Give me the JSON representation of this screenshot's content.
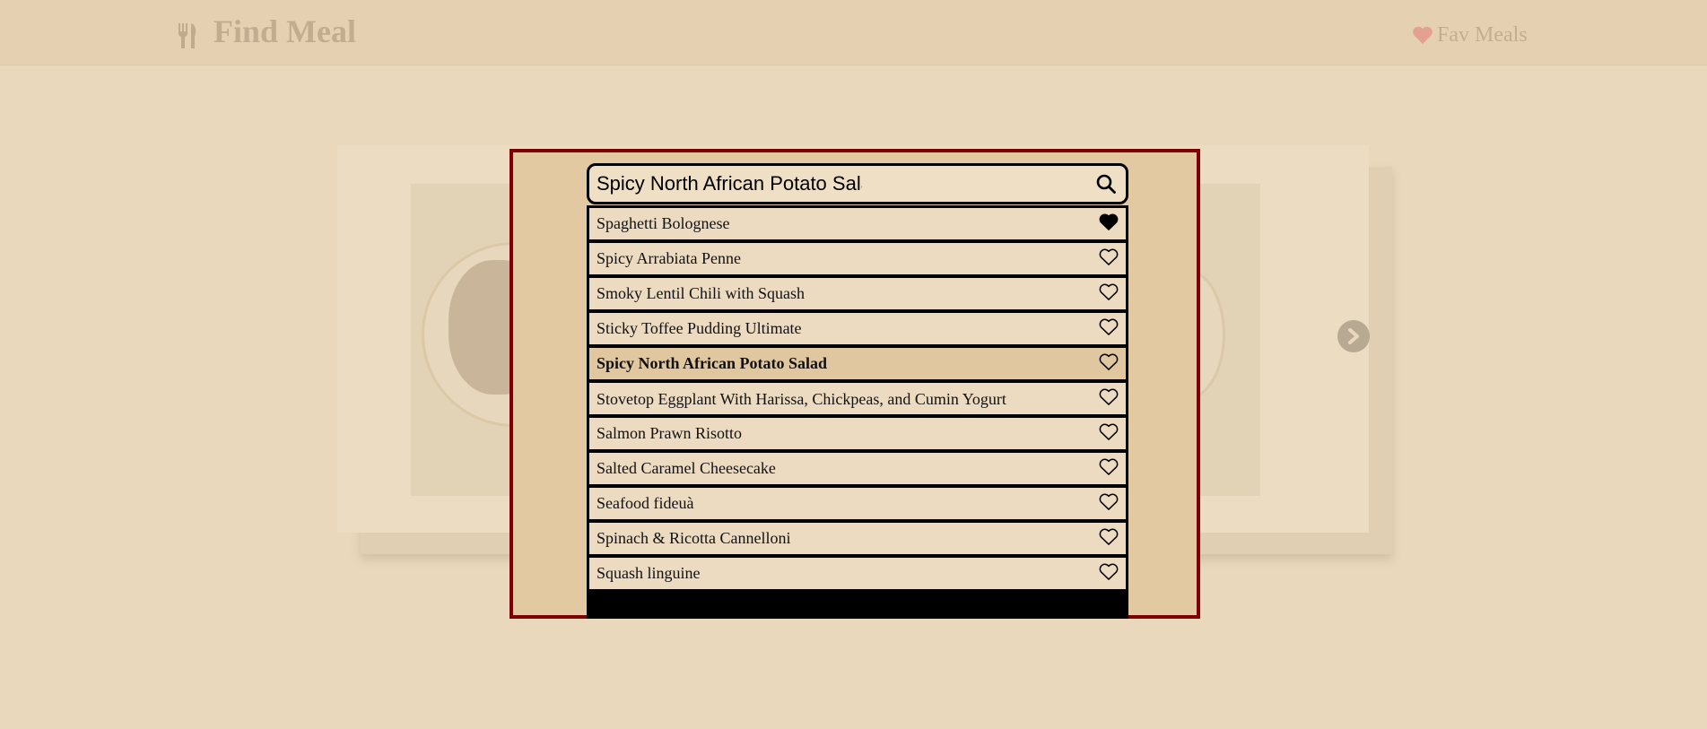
{
  "header": {
    "logo_icon": "utensils-icon",
    "title": "Find Meal",
    "fav_icon": "heart-icon",
    "fav_label": "Fav Meals"
  },
  "carousel": {
    "next_icon": "chevron-right-icon"
  },
  "search": {
    "value": "Spicy North African Potato Salad",
    "icon": "search-icon"
  },
  "results": [
    {
      "name": "Spaghetti Bolognese",
      "favorite": true
    },
    {
      "name": "Spicy Arrabiata Penne",
      "favorite": false
    },
    {
      "name": "Smoky Lentil Chili with Squash",
      "favorite": false
    },
    {
      "name": "Sticky Toffee Pudding Ultimate",
      "favorite": false
    },
    {
      "name": "Spicy North African Potato Salad",
      "favorite": false,
      "selected": true
    },
    {
      "name": "Stovetop Eggplant With Harissa, Chickpeas, and Cumin Yogurt",
      "favorite": false
    },
    {
      "name": "Salmon Prawn Risotto",
      "favorite": false
    },
    {
      "name": "Salted Caramel Cheesecake",
      "favorite": false
    },
    {
      "name": "Seafood fideuà",
      "favorite": false
    },
    {
      "name": "Spinach & Ricotta Cannelloni",
      "favorite": false
    },
    {
      "name": "Squash linguine",
      "favorite": false
    }
  ],
  "colors": {
    "modal_border": "#7f0000",
    "background": "#e9d8bc",
    "fav_heart": "#e3a191"
  }
}
